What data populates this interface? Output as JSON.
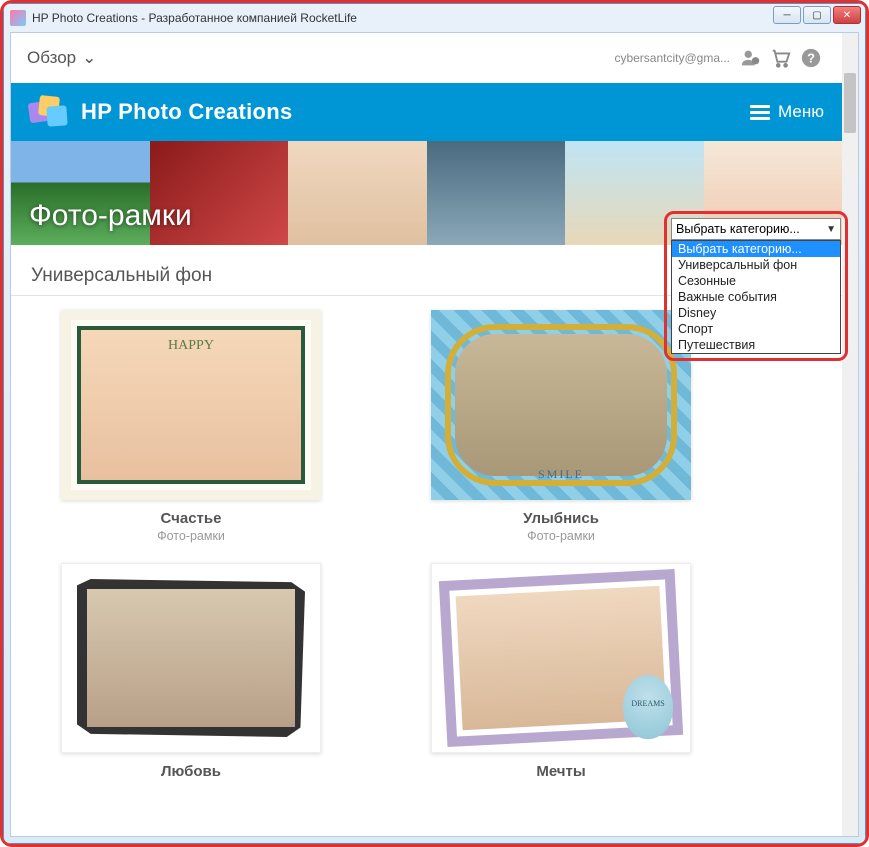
{
  "window": {
    "title": "HP Photo Creations - Разработанное компанией RocketLife"
  },
  "topbar": {
    "review_label": "Обзор",
    "email": "cybersantcity@gma..."
  },
  "header": {
    "app_title": "HP Photo Creations",
    "menu_label": "Меню"
  },
  "hero": {
    "title": "Фото-рамки"
  },
  "category_select": {
    "selected": "Выбрать категорию...",
    "options": [
      "Выбрать категорию...",
      "Универсальный фон",
      "Сезонные",
      "Важные события",
      "Disney",
      "Спорт",
      "Путешествия"
    ],
    "highlighted_index": 0
  },
  "section": {
    "heading": "Универсальный фон"
  },
  "cards": [
    {
      "title": "Счастье",
      "subtitle": "Фото-рамки",
      "badge": "HAPPY"
    },
    {
      "title": "Улыбнись",
      "subtitle": "Фото-рамки",
      "badge": "SMILE"
    },
    {
      "title": "Любовь",
      "subtitle": "",
      "badge": ""
    },
    {
      "title": "Мечты",
      "subtitle": "",
      "badge": "DREAMS"
    }
  ]
}
